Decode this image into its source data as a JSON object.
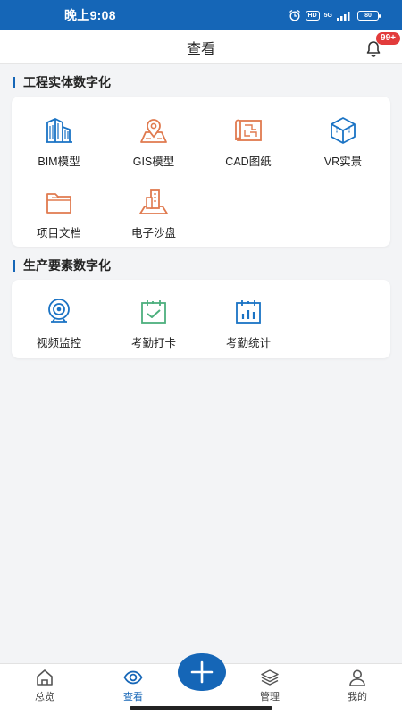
{
  "status_bar": {
    "time": "晚上9:08",
    "hd": "HD",
    "network": "5G",
    "battery": "80"
  },
  "header": {
    "title": "查看",
    "badge": "99+"
  },
  "sections": [
    {
      "title": "工程实体数字化",
      "items": [
        {
          "label": "BIM模型",
          "icon": "building-icon"
        },
        {
          "label": "GIS模型",
          "icon": "map-pin-icon"
        },
        {
          "label": "CAD图纸",
          "icon": "blueprint-icon"
        },
        {
          "label": "VR实景",
          "icon": "cube-icon"
        },
        {
          "label": "项目文档",
          "icon": "folder-icon"
        },
        {
          "label": "电子沙盘",
          "icon": "sandbox-icon"
        }
      ]
    },
    {
      "title": "生产要素数字化",
      "items": [
        {
          "label": "视频监控",
          "icon": "camera-icon"
        },
        {
          "label": "考勤打卡",
          "icon": "checkin-calendar-icon"
        },
        {
          "label": "考勤统计",
          "icon": "stats-calendar-icon"
        }
      ]
    }
  ],
  "bottom_nav": {
    "items": [
      {
        "label": "总览",
        "icon": "home-icon"
      },
      {
        "label": "查看",
        "icon": "eye-icon"
      },
      {
        "label": "管理",
        "icon": "layers-icon"
      },
      {
        "label": "我的",
        "icon": "user-icon"
      }
    ],
    "active": "查看"
  },
  "colors": {
    "brand": "#1566b7",
    "accent_orange": "#e07a4f",
    "accent_green": "#4caf7d",
    "badge": "#e23b3b"
  }
}
